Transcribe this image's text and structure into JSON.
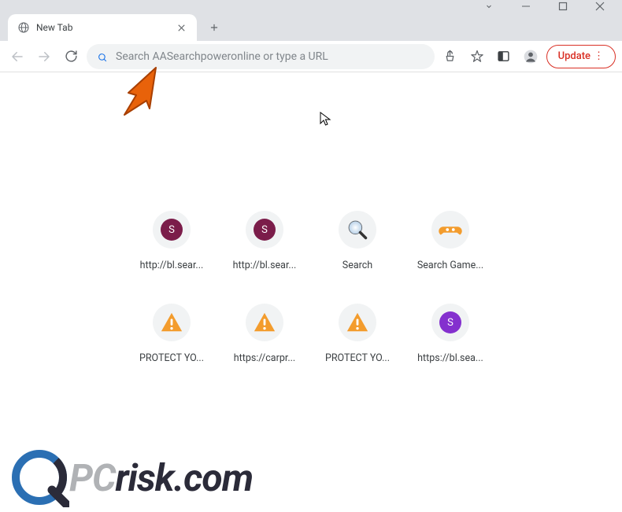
{
  "window": {
    "tab_title": "New Tab"
  },
  "omnibox": {
    "placeholder": "Search AASearchpoweronline or type a URL"
  },
  "toolbar": {
    "update_label": "Update"
  },
  "shortcuts": [
    {
      "label": "http://bl.sear...",
      "color": "#7b1d4a",
      "letter": "S",
      "kind": "letter"
    },
    {
      "label": "http://bl.sear...",
      "color": "#7b1d4a",
      "letter": "S",
      "kind": "letter"
    },
    {
      "label": "Search",
      "kind": "search"
    },
    {
      "label": "Search Game...",
      "kind": "gamepad"
    },
    {
      "label": "PROTECT YO...",
      "kind": "warning"
    },
    {
      "label": "https://carpr...",
      "kind": "warning"
    },
    {
      "label": "PROTECT YO...",
      "kind": "warning"
    },
    {
      "label": "https://bl.sea...",
      "color": "#8430ce",
      "letter": "S",
      "kind": "letter"
    }
  ],
  "watermark": {
    "text_gray": "PC",
    "text_dark": "risk.com"
  }
}
